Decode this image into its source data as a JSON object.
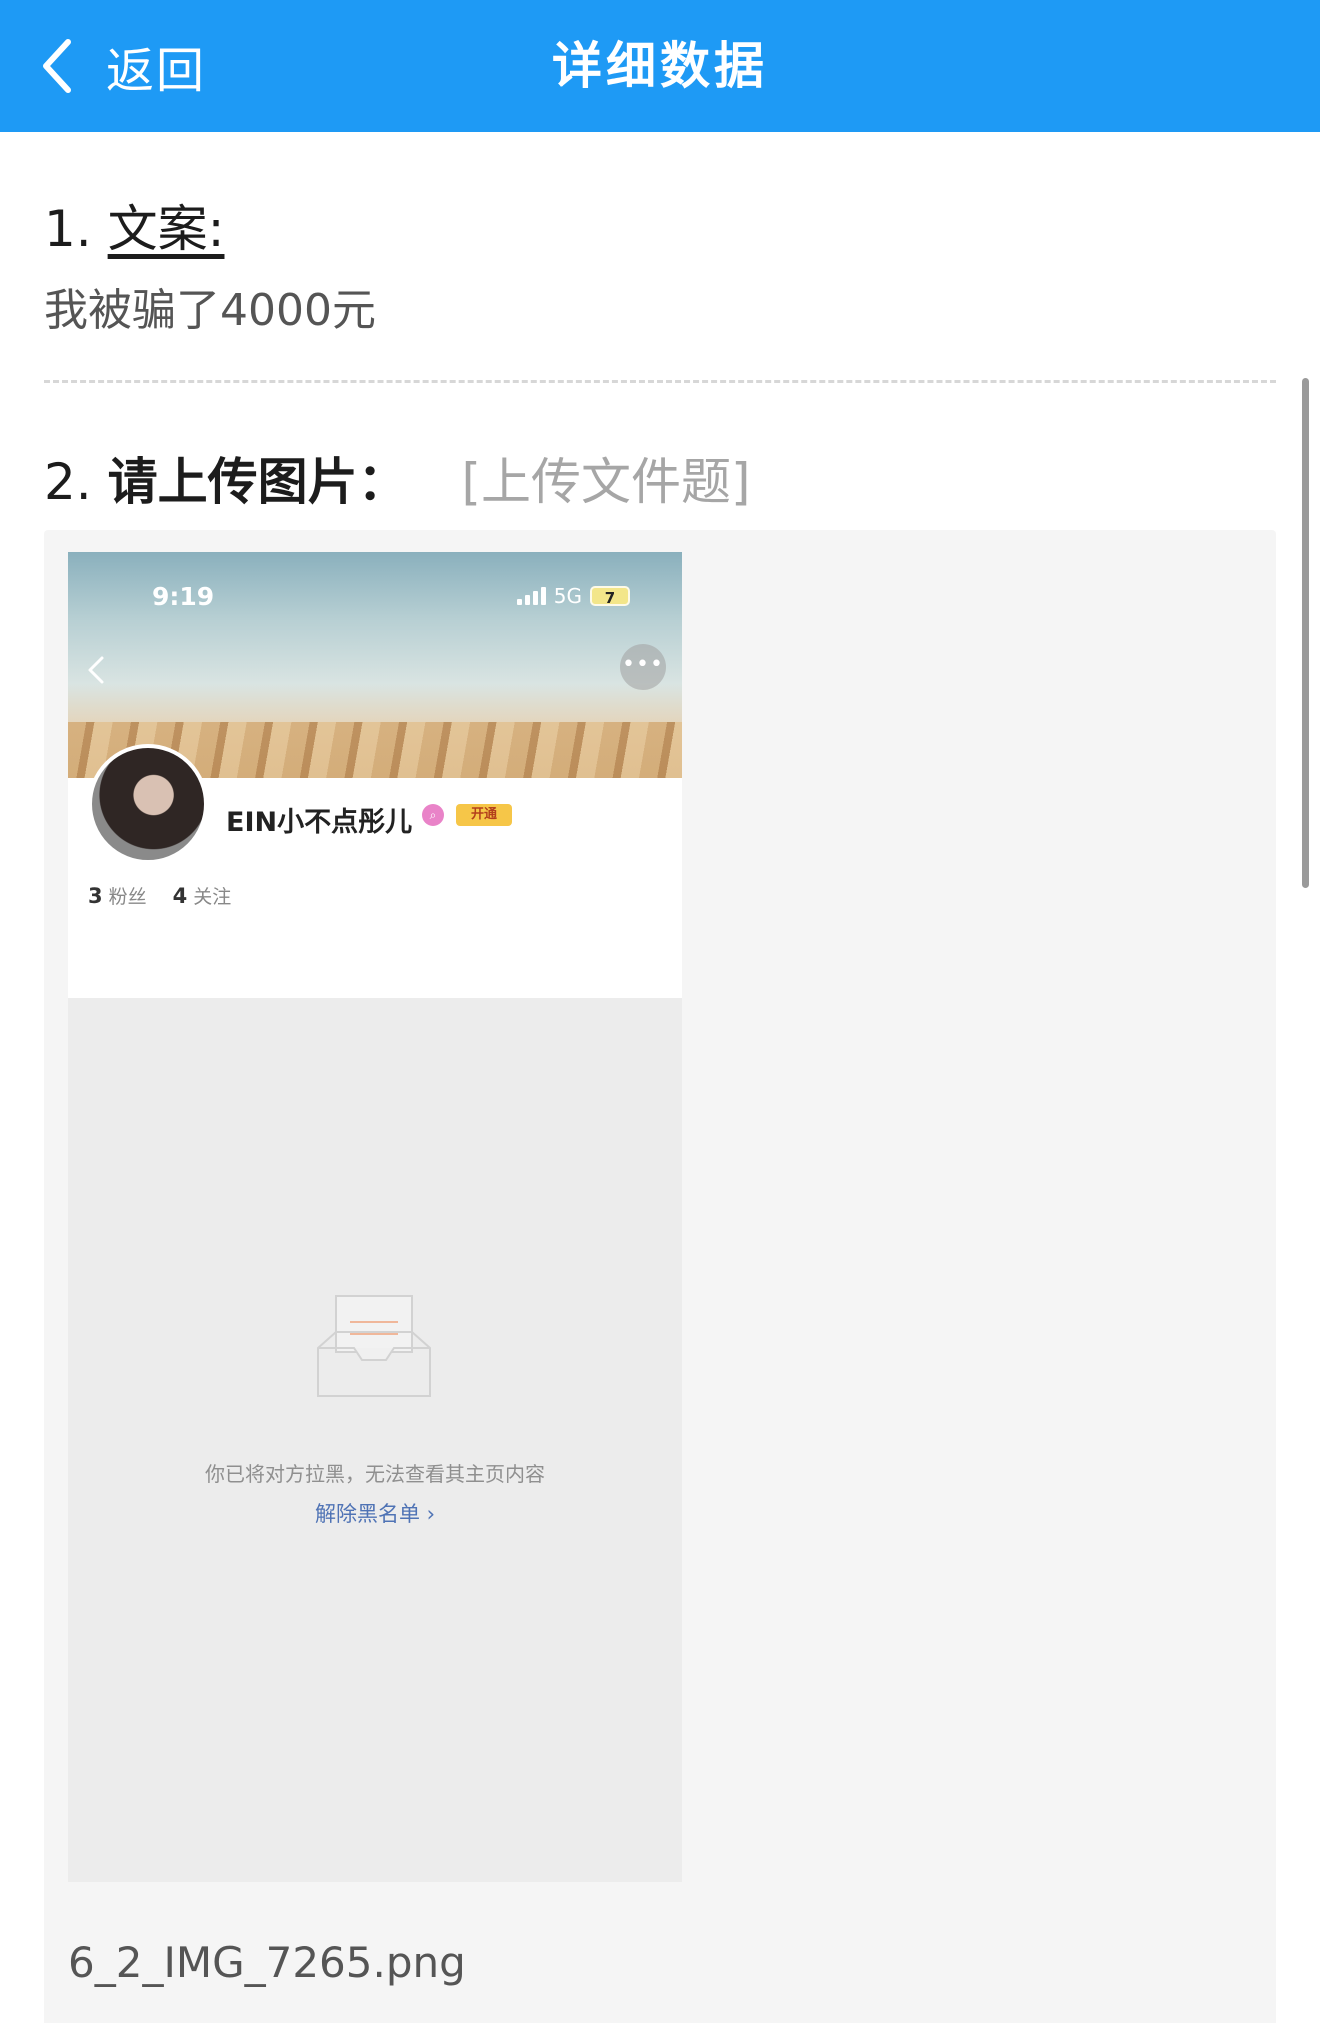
{
  "header": {
    "back_label": "返回",
    "title": "详细数据",
    "color": "#1e9af5"
  },
  "question1": {
    "number": "1.",
    "label": "文案:",
    "answer": "我被骗了4000元"
  },
  "question2": {
    "number": "2.",
    "label": "请上传图片：",
    "type_tag": "[上传文件题]",
    "file_name": "6_2_IMG_7265.png",
    "screenshot": {
      "time": "9:19",
      "network": "5G",
      "battery": "7",
      "username": "EIN小不点彤儿",
      "vip_badge": "开通",
      "fans_count": "3",
      "fans_label": "粉丝",
      "follow_count": "4",
      "follow_label": "关注",
      "blocked_message": "你已将对方拉黑，无法查看其主页内容",
      "unblock_link": "解除黑名单 ›"
    }
  }
}
